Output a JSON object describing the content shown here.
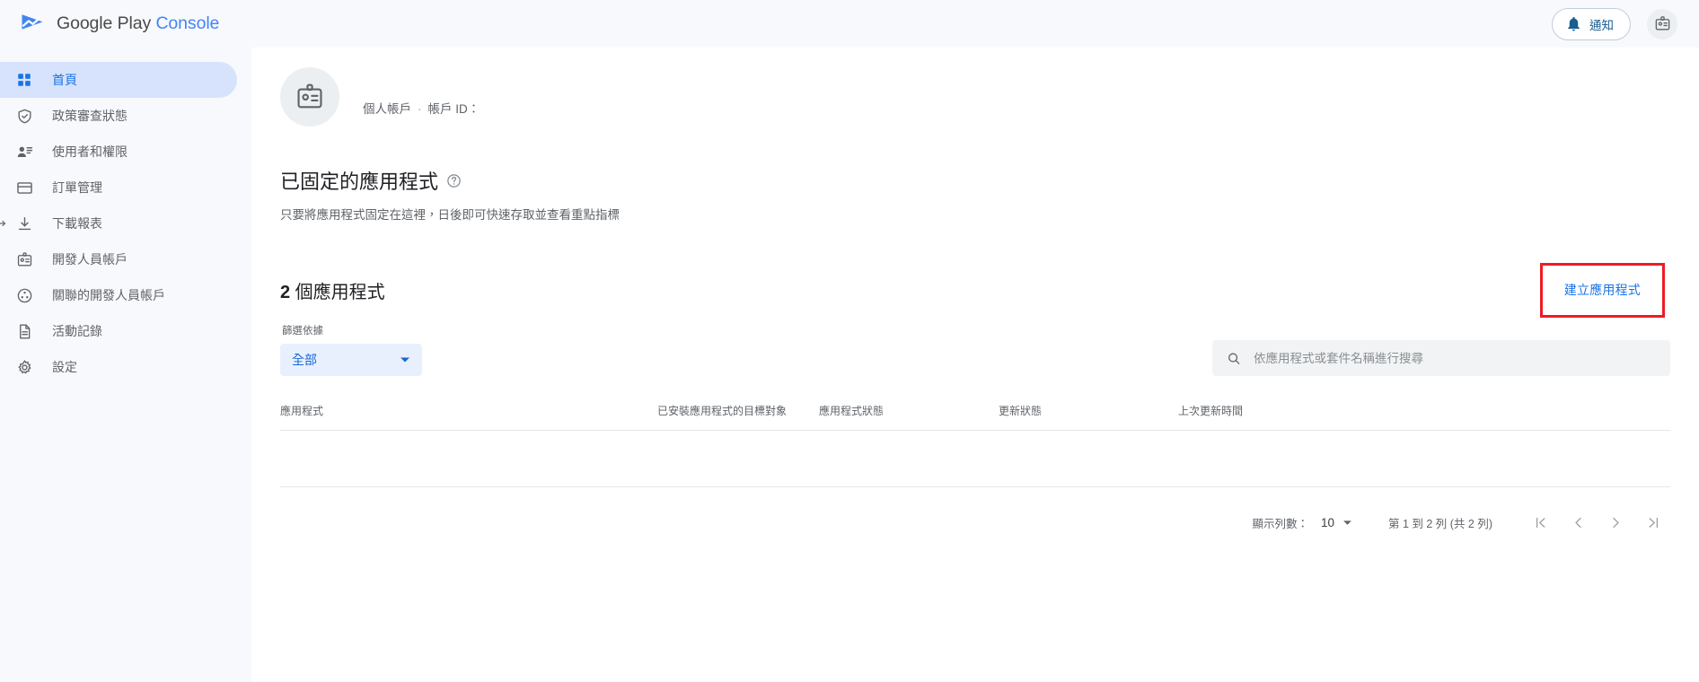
{
  "topbar": {
    "brand_first": "Google Play ",
    "brand_second": "Console",
    "logo_icon": "play-console-logo-icon",
    "notifications_label": "通知",
    "notifications_icon": "bell-icon",
    "account_badge_icon": "account-badge-icon",
    "background": "#f8f9fc"
  },
  "sidebar": {
    "active_bg": "#d7e3fc",
    "active_color": "#1a73e8",
    "items": [
      {
        "label": "首頁",
        "icon": "dashboard-grid-icon",
        "active": true
      },
      {
        "label": "政策審查狀態",
        "icon": "shield-check-icon",
        "active": false
      },
      {
        "label": "使用者和權限",
        "icon": "person-list-icon",
        "active": false
      },
      {
        "label": "訂單管理",
        "icon": "credit-card-icon",
        "active": false
      },
      {
        "label": "下載報表",
        "icon": "download-icon",
        "active": false
      },
      {
        "label": "開發人員帳戶",
        "icon": "id-badge-icon",
        "active": false
      },
      {
        "label": "關聯的開發人員帳戶",
        "icon": "linked-accounts-icon",
        "active": false
      },
      {
        "label": "活動記錄",
        "icon": "document-icon",
        "active": false
      },
      {
        "label": "設定",
        "icon": "gear-icon",
        "active": false
      }
    ]
  },
  "account": {
    "avatar_icon": "id-badge-icon",
    "type_label": "個人帳戶",
    "separator": "·",
    "id_label": "帳戶 ID：",
    "id_value": ""
  },
  "pinned_section": {
    "title": "已固定的應用程式",
    "help_icon": "help-circle-icon",
    "description": "只要將應用程式固定在這裡，日後即可快速存取並查看重點指標"
  },
  "apps_section": {
    "count_prefix": "2",
    "count_suffix": " 個應用程式",
    "create_button_label": "建立應用程式",
    "create_button_color": "#1a73e8",
    "highlight_color": "#ee1c25",
    "filter": {
      "label": "篩選依據",
      "value": "全部",
      "chevron_icon": "chevron-down-icon"
    },
    "search": {
      "placeholder": "依應用程式或套件名稱進行搜尋",
      "value": "",
      "icon": "search-icon"
    },
    "table": {
      "columns": [
        "應用程式",
        "已安裝應用程式的目標對象",
        "應用程式狀態",
        "更新狀態",
        "上次更新時間"
      ],
      "rows": []
    },
    "pagination": {
      "rows_label": "顯示列數：",
      "rows_value": "10",
      "rows_chevron_icon": "chevron-down-icon",
      "range_label": "第 1 到 2 列 (共 2 列)",
      "buttons": [
        {
          "name": "first-page",
          "icon": "first-page-icon"
        },
        {
          "name": "prev-page",
          "icon": "chevron-left-icon"
        },
        {
          "name": "next-page",
          "icon": "chevron-right-icon"
        },
        {
          "name": "last-page",
          "icon": "last-page-icon"
        }
      ]
    }
  }
}
